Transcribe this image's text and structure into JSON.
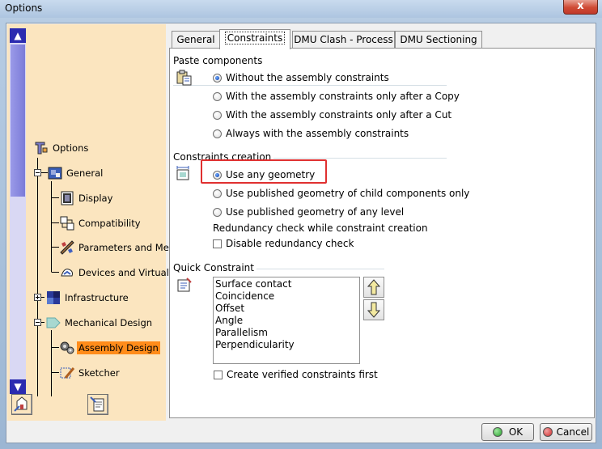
{
  "window": {
    "title": "Options",
    "close_glyph": "x"
  },
  "tree": {
    "scroll_up_glyph": "▲",
    "scroll_down_glyph": "▼",
    "items": [
      {
        "label": "Options",
        "icon": "options-icon"
      },
      {
        "label": "General",
        "icon": "general-icon"
      },
      {
        "label": "Display",
        "icon": "display-icon"
      },
      {
        "label": "Compatibility",
        "icon": "compatibility-icon"
      },
      {
        "label": "Parameters and Meas",
        "icon": "parameters-icon"
      },
      {
        "label": "Devices and Virtual R",
        "icon": "devices-icon"
      },
      {
        "label": "Infrastructure",
        "icon": "infrastructure-icon"
      },
      {
        "label": "Mechanical Design",
        "icon": "mechanical-design-icon"
      },
      {
        "label": "Assembly Design",
        "icon": "assembly-design-icon",
        "selected": true
      },
      {
        "label": "Sketcher",
        "icon": "sketcher-icon"
      }
    ]
  },
  "tabs": [
    "General",
    "Constraints",
    "DMU Clash - Process",
    "DMU Sectioning"
  ],
  "active_tab": "Constraints",
  "paste_components": {
    "label": "Paste components",
    "options": [
      {
        "label": "Without the assembly constraints",
        "selected": true
      },
      {
        "label": "With the assembly constraints only after a Copy",
        "selected": false
      },
      {
        "label": "With the assembly constraints only after a Cut",
        "selected": false
      },
      {
        "label": "Always with the assembly constraints",
        "selected": false
      }
    ]
  },
  "constraints_creation": {
    "label": "Constraints creation",
    "options": [
      {
        "label": "Use any geometry",
        "selected": true
      },
      {
        "label": "Use published geometry of child components only",
        "selected": false
      },
      {
        "label": "Use published geometry of any level",
        "selected": false
      }
    ],
    "redundancy_label": "Redundancy check while constraint creation",
    "redundancy_checkbox": {
      "label": "Disable redundancy check",
      "checked": false
    }
  },
  "quick_constraint": {
    "label": "Quick Constraint",
    "items": [
      "Surface contact",
      "Coincidence",
      "Offset",
      "Angle",
      "Parallelism",
      "Perpendicularity"
    ],
    "verified_checkbox": {
      "label": "Create verified constraints first",
      "checked": false
    }
  },
  "buttons": {
    "ok": "OK",
    "cancel": "Cancel"
  },
  "colors": {
    "tree_bg": "#fbe5bf",
    "selection": "#ff8c1a",
    "highlight": "#e03030",
    "ok_dot": "#27a12b",
    "cancel_dot": "#d02b2b"
  }
}
